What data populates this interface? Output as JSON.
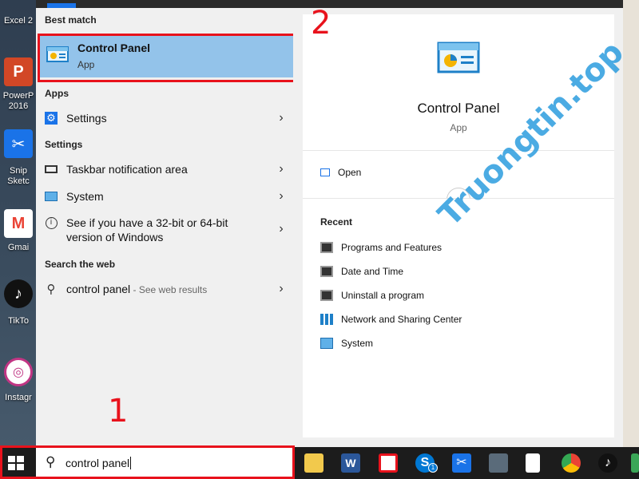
{
  "desktop": {
    "icons": [
      {
        "label": "Excel 2",
        "color": "#1d6f42"
      },
      {
        "label": "PowerP 2016",
        "color": "#d24726"
      },
      {
        "label": "Snip Sketc",
        "color": "#1a73e8"
      },
      {
        "label": "Gmai",
        "color": "#ea4335"
      },
      {
        "label": "TikTo",
        "color": "#111111"
      },
      {
        "label": "Instagr",
        "color": "#c13584"
      }
    ]
  },
  "start_menu": {
    "best_match_header": "Best match",
    "best_match": {
      "title": "Control Panel",
      "subtitle": "App"
    },
    "apps_header": "Apps",
    "apps": [
      {
        "label": "Settings"
      }
    ],
    "settings_header": "Settings",
    "settings": [
      {
        "label": "Taskbar notification area"
      },
      {
        "label": "System"
      },
      {
        "label": "See if you have a 32-bit or 64-bit version of Windows"
      }
    ],
    "web_header": "Search the web",
    "web": {
      "label": "control panel",
      "suffix": " - See web results"
    }
  },
  "detail": {
    "title": "Control Panel",
    "subtitle": "App",
    "open_label": "Open",
    "recent_header": "Recent",
    "recent": [
      {
        "label": "Programs and Features"
      },
      {
        "label": "Date and Time"
      },
      {
        "label": "Uninstall a program"
      },
      {
        "label": "Network and Sharing Center"
      },
      {
        "label": "System"
      }
    ]
  },
  "taskbar": {
    "search_value": "control panel",
    "badge": "1"
  },
  "annotations": {
    "one": "1",
    "two": "2"
  },
  "watermark": "Truongtin.top",
  "colors": {
    "highlight": "#93c3ea",
    "annotation": "#e8121c",
    "accent": "#1a73e8"
  }
}
